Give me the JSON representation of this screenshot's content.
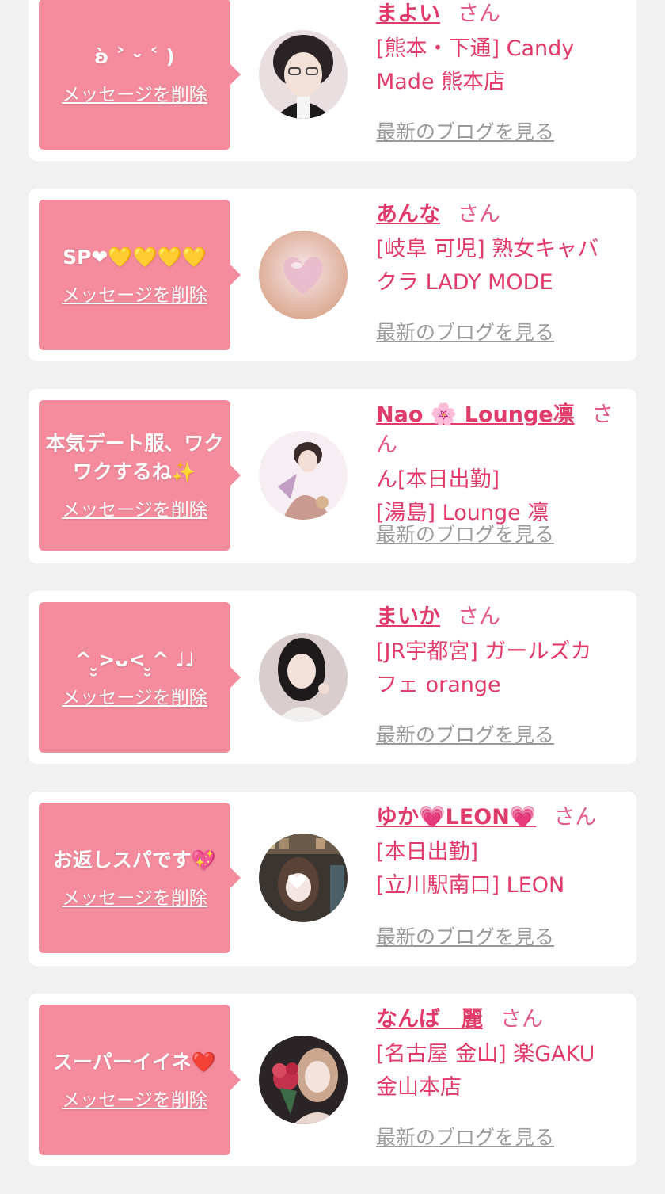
{
  "delete_label": "メッセージを削除",
  "san_label": "さん",
  "blog_label": "最新のブログを見る",
  "colors": {
    "bubble": "#f48c9d",
    "accent_text": "#e03b6a",
    "link_gray": "#9a9a9a",
    "background": "#f1f1f1"
  },
  "entries": [
    {
      "message": "ʚ̀ ˃ ᵕ ˂ )",
      "name": "まよい",
      "shop_lines": [
        "[熊本・下通] Candy",
        "Made 熊本店"
      ]
    },
    {
      "message": "SP❤︎💛💛💛💛",
      "name": "あんな",
      "shop_lines": [
        "[岐阜 可児] 熟女キャバ",
        "クラ LADY MODE"
      ]
    },
    {
      "message": "本気デート服、ワクワクするね✨",
      "name": "Nao 🌸 Lounge凛",
      "shop_lines": [
        "ん[本日出勤]",
        "[湯島] Lounge 凛"
      ]
    },
    {
      "message": "^ ̮̮>ᴗ< ̮̮^ ♩♩",
      "name": "まいか",
      "shop_lines": [
        "[JR宇都宮] ガールズカ",
        "フェ orange"
      ]
    },
    {
      "message": "お返しスパです💖",
      "name": "ゆか💗LEON💗",
      "shop_lines": [
        "[本日出勤]",
        "[立川駅南口] LEON"
      ]
    },
    {
      "message": "スーパーイイネ❤️",
      "name": "なんば　麗",
      "shop_lines": [
        "[名古屋 金山] 楽GAKU",
        "金山本店"
      ]
    }
  ]
}
